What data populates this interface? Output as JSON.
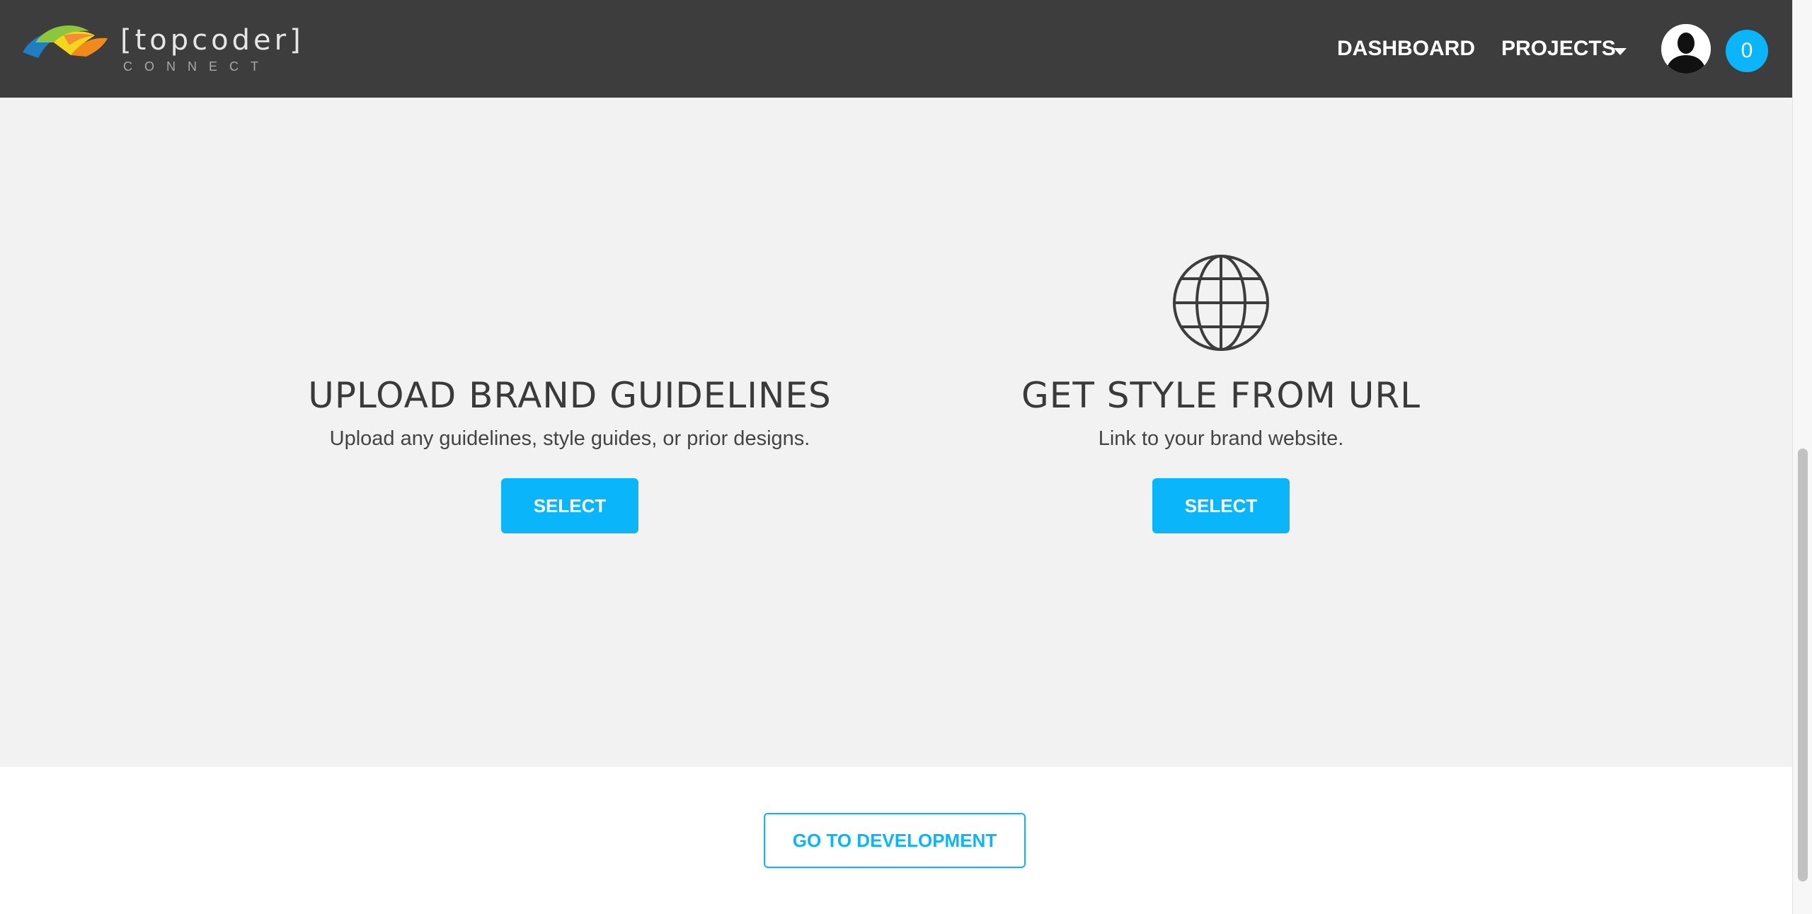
{
  "header": {
    "logo": {
      "wordmark": "[topcoder]",
      "subtitle": "CONNECT"
    },
    "nav": {
      "dashboard": "DASHBOARD",
      "projects": "PROJECTS"
    },
    "notifications_count": "0",
    "icons": {
      "logo": "topcoder-logo",
      "caret": "chevron-down-icon",
      "avatar": "user-avatar-icon"
    }
  },
  "options": [
    {
      "title": "UPLOAD BRAND GUIDELINES",
      "description": "Upload any guidelines, style guides, or prior designs.",
      "button": "SELECT"
    },
    {
      "icon": "globe-icon",
      "title": "GET STYLE FROM URL",
      "description": "Link to your brand website.",
      "button": "SELECT"
    }
  ],
  "footer": {
    "button": "GO TO DEVELOPMENT"
  },
  "colors": {
    "header_bg": "#3d3d3d",
    "accent": "#0ab5f9",
    "section_bg": "#f2f2f2",
    "text_dark": "#3a3a3a"
  }
}
